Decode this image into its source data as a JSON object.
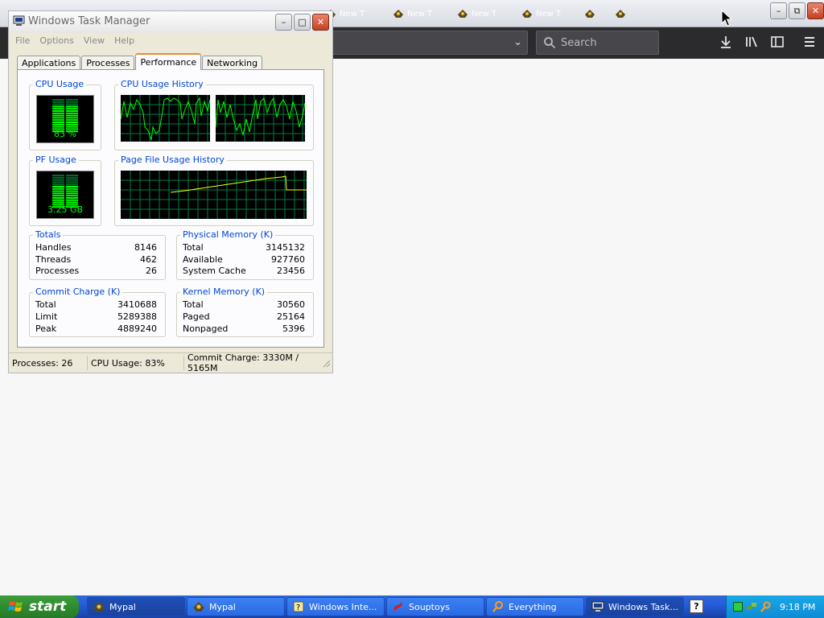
{
  "browser": {
    "tabs": [
      {
        "label": "New T",
        "icon": "mypal-icon"
      },
      {
        "label": "New T",
        "icon": "mypal-icon"
      },
      {
        "label": "New T",
        "icon": "mypal-icon"
      },
      {
        "label": "New T",
        "icon": "mypal-icon"
      },
      {
        "label": "",
        "icon": "mypal-icon"
      },
      {
        "label": "",
        "icon": "mypal-icon"
      }
    ],
    "search_placeholder": "Search"
  },
  "taskmanager": {
    "title": "Windows Task Manager",
    "menu": [
      "File",
      "Options",
      "View",
      "Help"
    ],
    "tabs": [
      "Applications",
      "Processes",
      "Performance",
      "Networking"
    ],
    "active_tab": "Performance",
    "cpu_usage_label": "CPU Usage",
    "cpu_usage_value": "83 %",
    "cpu_usage_fraction": 0.83,
    "cpu_history_label": "CPU Usage History",
    "pf_usage_label": "PF Usage",
    "pf_usage_value": "3.25 GB",
    "pf_usage_fraction": 0.64,
    "pf_history_label": "Page File Usage History",
    "totals": {
      "label": "Totals",
      "rows": [
        {
          "name": "Handles",
          "value": "8146"
        },
        {
          "name": "Threads",
          "value": "462"
        },
        {
          "name": "Processes",
          "value": "26"
        }
      ]
    },
    "physical": {
      "label": "Physical Memory (K)",
      "rows": [
        {
          "name": "Total",
          "value": "3145132"
        },
        {
          "name": "Available",
          "value": "927760"
        },
        {
          "name": "System Cache",
          "value": "23456"
        }
      ]
    },
    "commit": {
      "label": "Commit Charge (K)",
      "rows": [
        {
          "name": "Total",
          "value": "3410688"
        },
        {
          "name": "Limit",
          "value": "5289388"
        },
        {
          "name": "Peak",
          "value": "4889240"
        }
      ]
    },
    "kernel": {
      "label": "Kernel Memory (K)",
      "rows": [
        {
          "name": "Total",
          "value": "30560"
        },
        {
          "name": "Paged",
          "value": "25164"
        },
        {
          "name": "Nonpaged",
          "value": "5396"
        }
      ]
    },
    "status": {
      "processes": "Processes: 26",
      "cpu": "CPU Usage: 83%",
      "commit": "Commit Charge: 3330M / 5165M"
    }
  },
  "taskbar": {
    "start_label": "start",
    "tasks": [
      {
        "label": "Mypal",
        "icon": "mypal-icon",
        "active": true
      },
      {
        "label": "Mypal",
        "icon": "mypal-icon",
        "active": false
      },
      {
        "label": "Windows Inte...",
        "icon": "windows-installer-icon",
        "active": false
      },
      {
        "label": "Souptoys",
        "icon": "souptoys-icon",
        "active": false
      },
      {
        "label": "Everything",
        "icon": "everything-search-icon",
        "active": false
      },
      {
        "label": "Windows Task...",
        "icon": "task-manager-icon",
        "active": true
      }
    ],
    "clock": "9:18 PM"
  },
  "colors": {
    "xp_blue": "#245edb",
    "start_green": "#2f8b2f",
    "graph_green": "#00ff00",
    "graph_grid": "#008040",
    "pf_line": "#ffff00",
    "group_label": "#0046d5"
  }
}
